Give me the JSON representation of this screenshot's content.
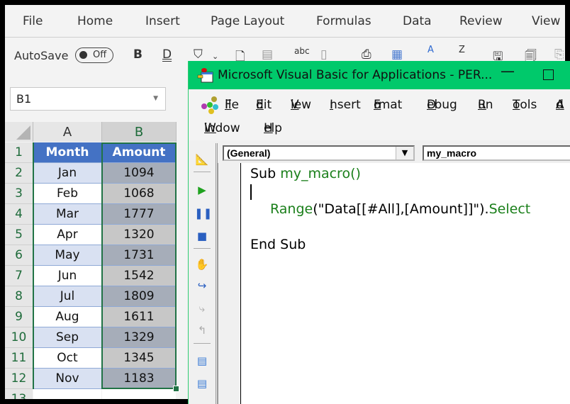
{
  "excel": {
    "ribbon_tabs": [
      "File",
      "Home",
      "Insert",
      "Page Layout",
      "Formulas",
      "Data",
      "Review",
      "View"
    ],
    "autosave_label": "AutoSave",
    "autosave_state": "Off",
    "toolbar_icons": [
      "bold-icon",
      "double-underline-icon",
      "fill-color-icon",
      "new-document-icon",
      "form-icon",
      "spelling-icon",
      "sheet-icon",
      "clipboard-icon",
      "table-format-icon",
      "sort-az-icon",
      "sort-za-icon",
      "save-as-icon",
      "copy-icon",
      "paste-icon"
    ],
    "bold_label": "B",
    "underline_label": "D",
    "spelling_label": "abc",
    "sort_az_label": "A",
    "sort_za_label": "Z",
    "name_box": "B1",
    "columns": [
      "A",
      "B"
    ],
    "row_numbers": [
      "1",
      "2",
      "3",
      "4",
      "5",
      "6",
      "7",
      "8",
      "9",
      "10",
      "11",
      "12",
      "13"
    ],
    "table": {
      "headers": [
        "Month",
        "Amount"
      ],
      "rows": [
        [
          "Jan",
          "1094"
        ],
        [
          "Feb",
          "1068"
        ],
        [
          "Mar",
          "1777"
        ],
        [
          "Apr",
          "1320"
        ],
        [
          "May",
          "1731"
        ],
        [
          "Jun",
          "1542"
        ],
        [
          "Jul",
          "1809"
        ],
        [
          "Aug",
          "1611"
        ],
        [
          "Sep",
          "1329"
        ],
        [
          "Oct",
          "1345"
        ],
        [
          "Nov",
          "1183"
        ]
      ]
    },
    "colors": {
      "header": "#4472c4",
      "selection": "#217346"
    }
  },
  "vba": {
    "title": "Microsoft Visual Basic for Applications - PER...",
    "menu": [
      {
        "label": "File",
        "key": "F",
        "rest": "ile"
      },
      {
        "label": "Edit",
        "key": "E",
        "rest": "dit"
      },
      {
        "label": "View",
        "key": "V",
        "rest": "iew"
      },
      {
        "label": "Insert",
        "key": "I",
        "rest": "nsert"
      },
      {
        "label": "Format",
        "pre": "F",
        "key": "o",
        "rest": "rmat"
      },
      {
        "label": "Debug",
        "key": "D",
        "rest": "ebug"
      },
      {
        "label": "Run",
        "key": "R",
        "rest": "un"
      },
      {
        "label": "Tools",
        "key": "T",
        "rest": "ools"
      },
      {
        "label": "Add-Ins",
        "key": "A",
        "rest": "d"
      },
      {
        "label": "Window",
        "key": "W",
        "rest": "indow"
      },
      {
        "label": "Help",
        "key": "H",
        "rest": "elp"
      }
    ],
    "object_combo": "(General)",
    "procedure_combo": "my_macro",
    "code": {
      "line1_kw": "Sub ",
      "line1_id": "my_macro()",
      "line3_id1": "Range",
      "line3_str": "(\"Data[[#All],[Amount]]\").",
      "line3_id2": "Select",
      "line5": "End Sub"
    },
    "title_bar_color": "#00c96b"
  }
}
